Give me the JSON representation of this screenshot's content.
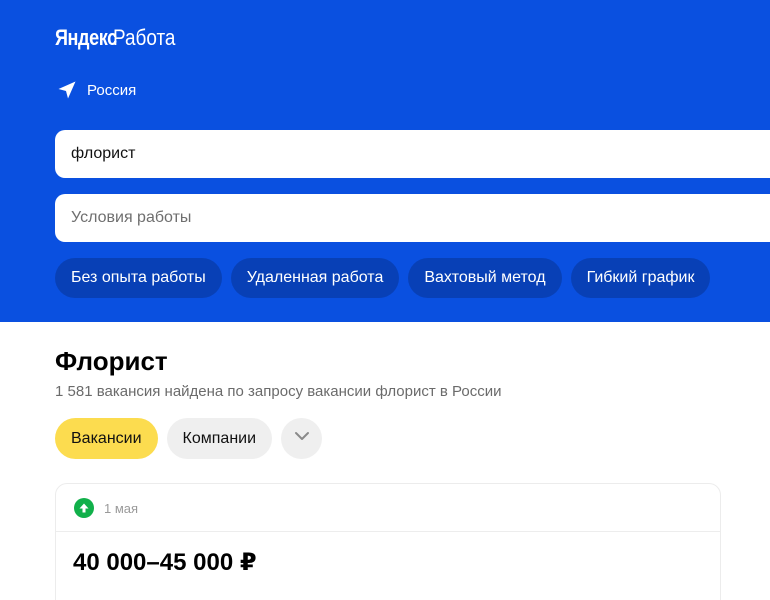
{
  "header": {
    "logo_brand": "Яндекс",
    "logo_product": "Работа",
    "region": "Россия"
  },
  "search": {
    "query_value": "флорист",
    "conditions_placeholder": "Условия работы"
  },
  "filter_chips": [
    {
      "label": "Без опыта работы"
    },
    {
      "label": "Удаленная работа"
    },
    {
      "label": "Вахтовый метод"
    },
    {
      "label": "Гибкий график"
    }
  ],
  "results": {
    "title": "Флорист",
    "subtitle": "1 581 вакансия найдена по запросу вакансии флорист в России"
  },
  "tabs": [
    {
      "label": "Вакансии",
      "active": true
    },
    {
      "label": "Компании",
      "active": false
    }
  ],
  "vacancy": {
    "date": "1 мая",
    "salary": "40 000–45 000 ₽"
  },
  "colors": {
    "hero_background": "#0a50e0",
    "chip_background": "#0840b6",
    "active_tab": "#fcdc4f",
    "badge_green": "#11b04a"
  },
  "icons": {
    "region": "location-arrow-icon",
    "more_tabs": "chevron-down-icon",
    "vacancy_badge": "arrow-up-icon"
  }
}
